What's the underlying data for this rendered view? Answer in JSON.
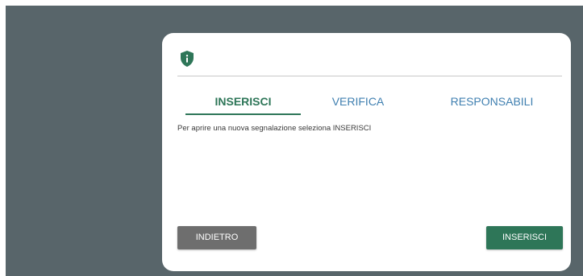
{
  "colors": {
    "backdrop": "#58656a",
    "accent_green": "#2e7658",
    "tab_blue": "#3f7fb0",
    "back_button": "#6e6e6e"
  },
  "header": {
    "icon": "shield-info-icon"
  },
  "tabs": [
    {
      "label": "INSERISCI",
      "active": true
    },
    {
      "label": "VERIFICA",
      "active": false
    },
    {
      "label": "RESPONSABILI",
      "active": false
    }
  ],
  "content": {
    "instructions": "Per aprire una nuova segnalazione seleziona INSERISCI"
  },
  "footer": {
    "back_label": "INDIETRO",
    "insert_label": "INSERISCI"
  }
}
